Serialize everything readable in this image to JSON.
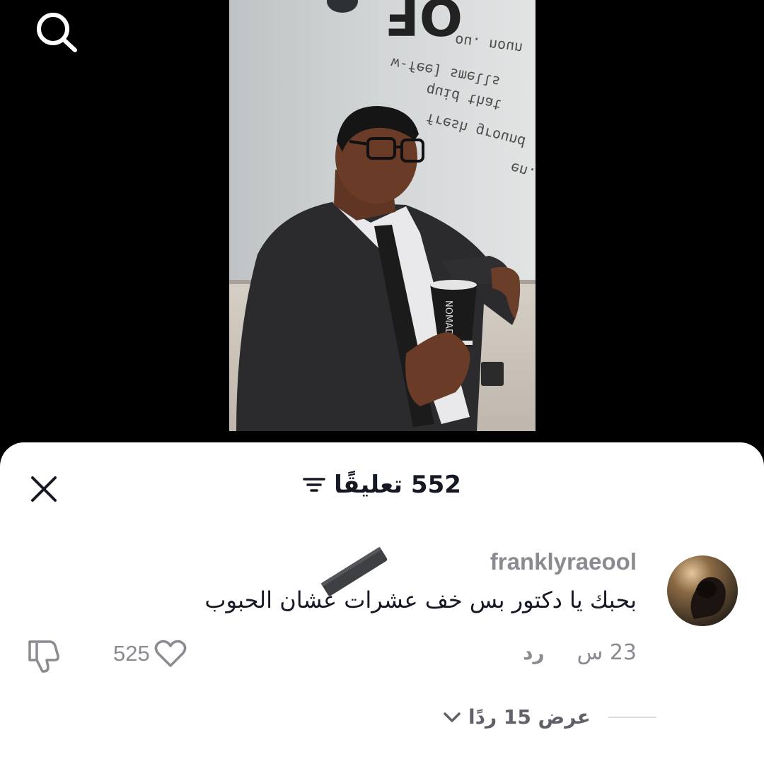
{
  "header": {
    "search_icon": "search-icon"
  },
  "video": {
    "wall_text": {
      "line1": "ou. noun",
      "line2": "w-fee] smells",
      "line3": "quid that",
      "line4": "fresh ground",
      "line5": "en."
    },
    "cup_brand": "NOMAD"
  },
  "comments_sheet": {
    "count": "552",
    "title_label": "تعليقًا",
    "close_icon": "close-icon",
    "filter_icon": "filter-icon"
  },
  "comment": {
    "username": "franklyraeool",
    "text": "بحبك يا دكتور بس خف عشرات عشان الحبوب",
    "timestamp": "23 س",
    "reply_label": "رد",
    "like_count": "525",
    "replies_label": "عرض 15 ردًا"
  },
  "colors": {
    "sheet_bg": "#ffffff",
    "primary_text": "#161823",
    "secondary_text": "#8a8b91"
  }
}
